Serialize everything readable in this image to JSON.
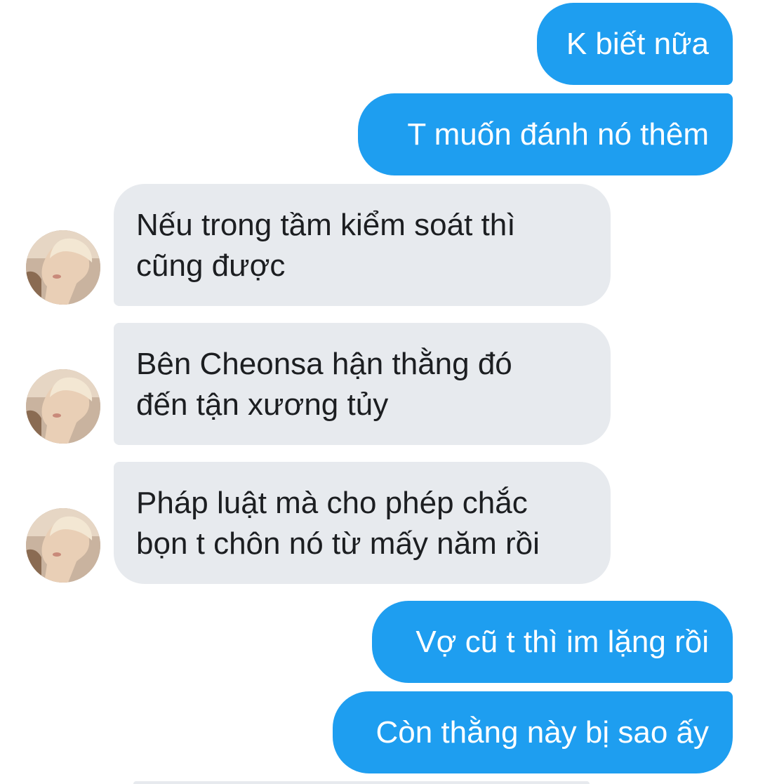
{
  "conversation": {
    "messages": [
      {
        "side": "sent",
        "text": "K biết nữa"
      },
      {
        "side": "sent",
        "text": "T muốn đánh nó thêm"
      },
      {
        "side": "received",
        "lines": [
          "Nếu trong tầm kiểm soát thì",
          "cũng được"
        ]
      },
      {
        "side": "received",
        "lines": [
          "Bên Cheonsa hận thằng đó",
          "đến tận xương tủy"
        ]
      },
      {
        "side": "received",
        "lines": [
          "Pháp luật mà cho phép chắc",
          "bọn t chôn nó từ mấy năm rồi"
        ]
      },
      {
        "side": "sent",
        "text": "Vợ cũ t thì im lặng rồi"
      },
      {
        "side": "sent",
        "text": "Còn thằng này bị sao ấy"
      }
    ]
  },
  "colors": {
    "sent_bubble": "#1e9ef0",
    "received_bubble": "#e7eaee",
    "received_text": "#1c1e21",
    "background": "#ffffff"
  },
  "icons": {
    "avatar": "contact-avatar-photo"
  }
}
